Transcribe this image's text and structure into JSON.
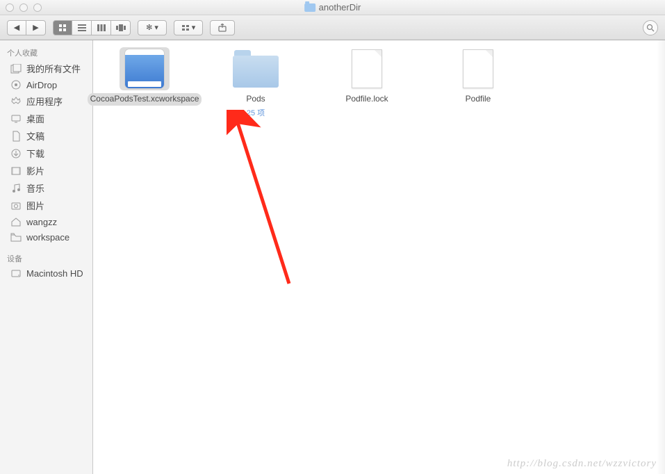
{
  "window": {
    "title": "anotherDir"
  },
  "sidebar": {
    "favorites_header": "个人收藏",
    "devices_header": "设备",
    "favorites": [
      {
        "label": "我的所有文件",
        "icon": "all-files"
      },
      {
        "label": "AirDrop",
        "icon": "airdrop"
      },
      {
        "label": "应用程序",
        "icon": "apps"
      },
      {
        "label": "桌面",
        "icon": "desktop"
      },
      {
        "label": "文稿",
        "icon": "documents"
      },
      {
        "label": "下载",
        "icon": "downloads"
      },
      {
        "label": "影片",
        "icon": "movies"
      },
      {
        "label": "音乐",
        "icon": "music"
      },
      {
        "label": "图片",
        "icon": "pictures"
      },
      {
        "label": "wangzz",
        "icon": "home"
      },
      {
        "label": "workspace",
        "icon": "folder"
      }
    ],
    "devices": [
      {
        "label": "Macintosh HD",
        "icon": "disk"
      }
    ]
  },
  "files": [
    {
      "name": "CocoaPodsTest.xcworkspace",
      "type": "workspace",
      "selected": true
    },
    {
      "name": "Pods",
      "type": "folder",
      "sub": "25 项"
    },
    {
      "name": "Podfile.lock",
      "type": "doc"
    },
    {
      "name": "Podfile",
      "type": "doc"
    }
  ],
  "watermark": "http://blog.csdn.net/wzzvictory"
}
